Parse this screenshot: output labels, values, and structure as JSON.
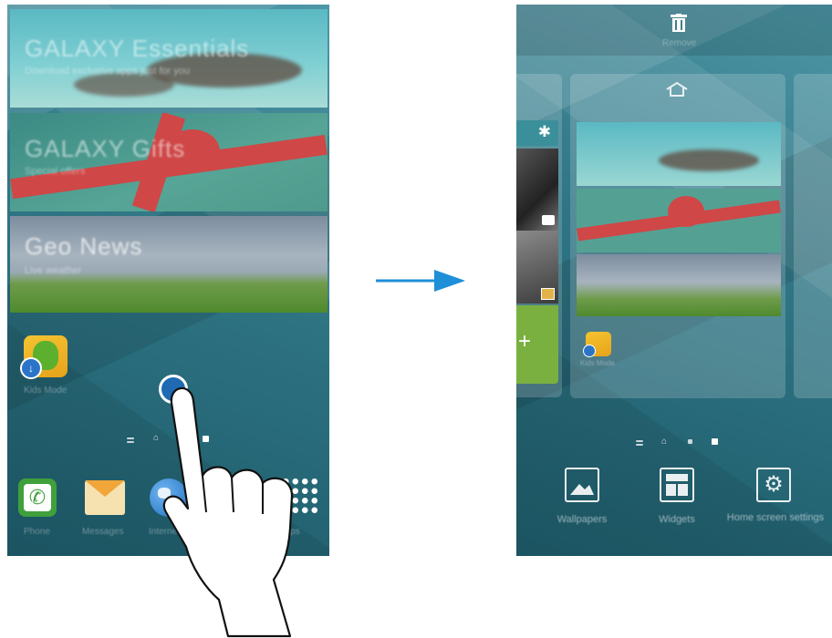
{
  "left_screen": {
    "widgets": [
      {
        "title": "GALAXY Essentials",
        "subtitle": "Download exclusive apps just for you"
      },
      {
        "title": "GALAXY Gifts",
        "subtitle": "Special offers"
      },
      {
        "title": "Geo News",
        "subtitle": "Live weather"
      }
    ],
    "app": {
      "label": "Kids Mode"
    },
    "dock": [
      {
        "label": "Phone"
      },
      {
        "label": "Messages"
      },
      {
        "label": "Internet"
      },
      {
        "label": "Apps"
      }
    ]
  },
  "right_screen": {
    "remove_label": "Remove",
    "options": [
      {
        "label": "Wallpapers"
      },
      {
        "label": "Widgets"
      },
      {
        "label": "Home screen settings"
      }
    ],
    "preview_app_label": "Kids Mode",
    "plus_symbol": "+"
  },
  "colors": {
    "arrow": "#1f8fd8",
    "screen": "#2f7584",
    "accent": "#7ab040"
  }
}
